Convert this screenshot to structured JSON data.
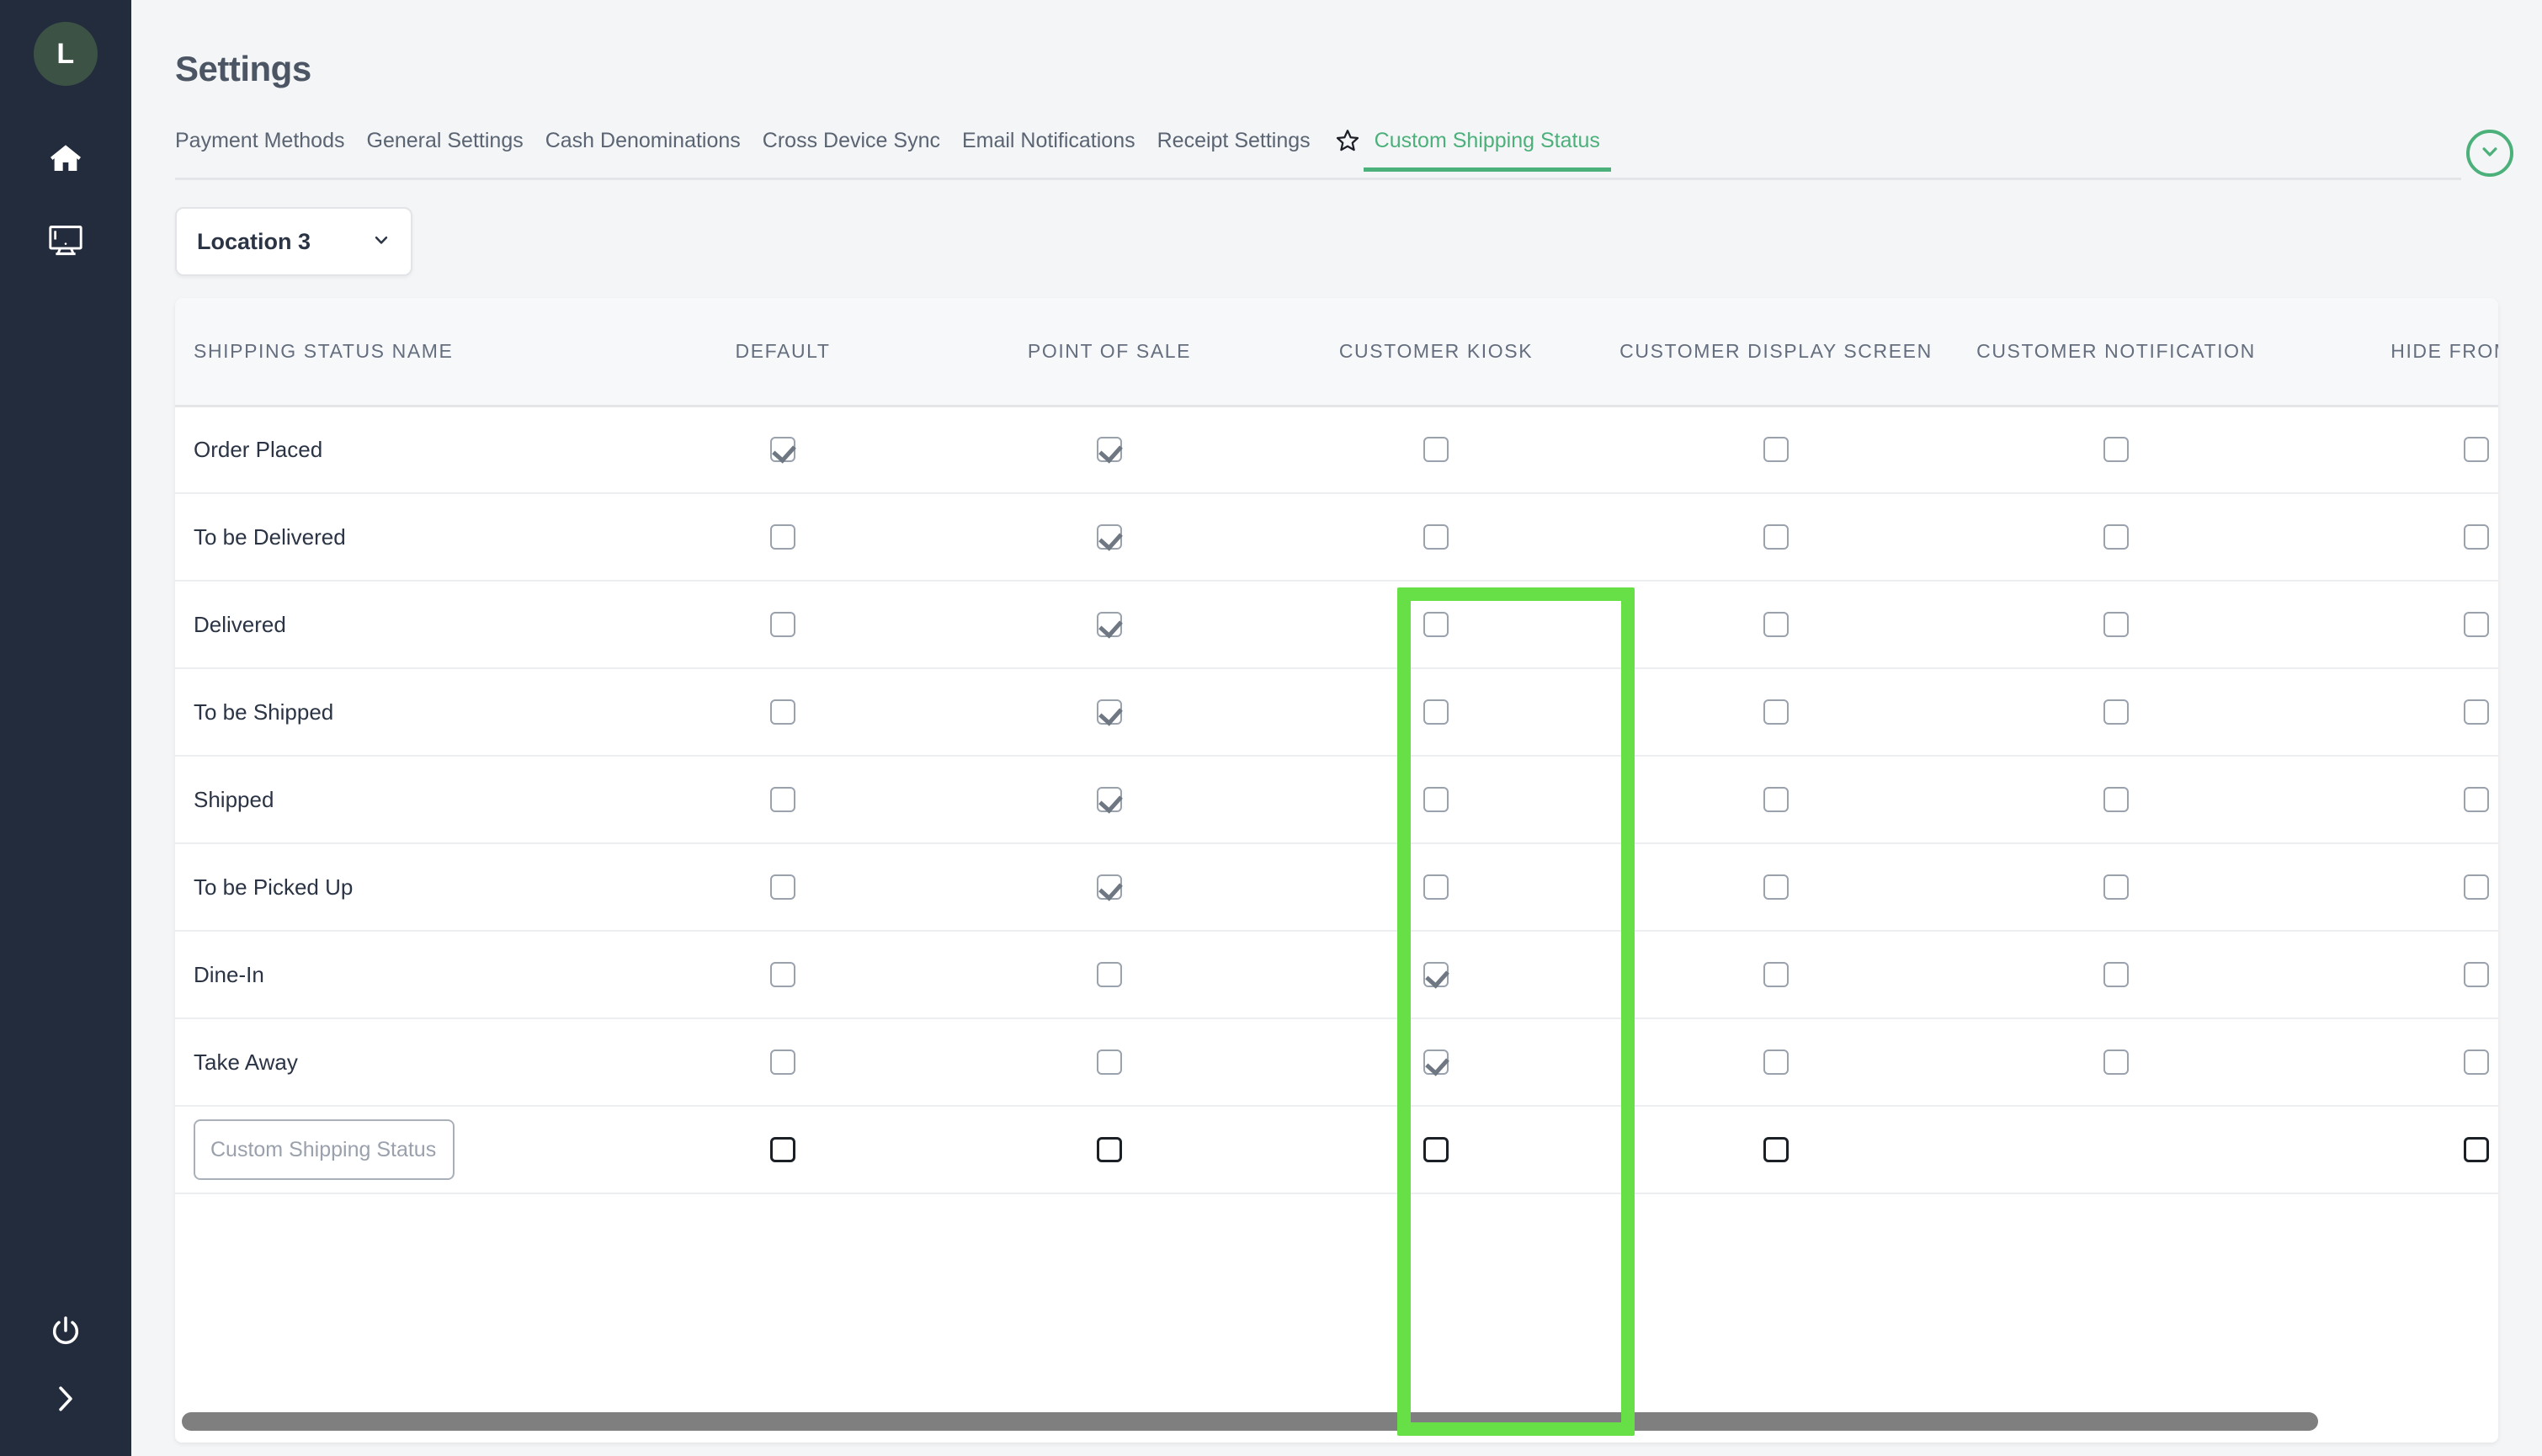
{
  "sidebar": {
    "avatar_initial": "L",
    "items": [
      {
        "name": "home-icon",
        "label": "Home"
      },
      {
        "name": "display-screen-icon",
        "label": "Display Screen"
      }
    ],
    "bottom_items": [
      {
        "name": "power-icon",
        "label": "Power"
      },
      {
        "name": "expand-chevron-icon",
        "label": "Expand"
      }
    ]
  },
  "header": {
    "title": "Settings"
  },
  "tabs": [
    {
      "label": "Payment Methods",
      "active": false
    },
    {
      "label": "General Settings",
      "active": false
    },
    {
      "label": "Cash Denominations",
      "active": false
    },
    {
      "label": "Cross Device Sync",
      "active": false
    },
    {
      "label": "Email Notifications",
      "active": false
    },
    {
      "label": "Receipt Settings",
      "active": false
    },
    {
      "label": "Custom Shipping Status",
      "active": true
    }
  ],
  "toolbar": {
    "collapse_icon": "chevron-down-icon",
    "star_icon": "star-outline-icon"
  },
  "location_select": {
    "value": "Location 3",
    "chevron": "chevron-down-icon"
  },
  "table": {
    "columns": [
      "SHIPPING STATUS NAME",
      "DEFAULT",
      "POINT OF SALE",
      "CUSTOMER KIOSK",
      "CUSTOMER DISPLAY SCREEN",
      "CUSTOMER NOTIFICATION",
      "HIDE FROM KDS"
    ],
    "rows": [
      {
        "name": "Order Placed",
        "default": true,
        "pos": true,
        "kiosk": false,
        "cds": false,
        "notification": false,
        "hide_kds": false
      },
      {
        "name": "To be Delivered",
        "default": false,
        "pos": true,
        "kiosk": false,
        "cds": false,
        "notification": false,
        "hide_kds": false
      },
      {
        "name": "Delivered",
        "default": false,
        "pos": true,
        "kiosk": false,
        "cds": false,
        "notification": false,
        "hide_kds": false
      },
      {
        "name": "To be Shipped",
        "default": false,
        "pos": true,
        "kiosk": false,
        "cds": false,
        "notification": false,
        "hide_kds": false
      },
      {
        "name": "Shipped",
        "default": false,
        "pos": true,
        "kiosk": false,
        "cds": false,
        "notification": false,
        "hide_kds": false
      },
      {
        "name": "To be Picked Up",
        "default": false,
        "pos": true,
        "kiosk": false,
        "cds": false,
        "notification": false,
        "hide_kds": false
      },
      {
        "name": "Dine-In",
        "default": false,
        "pos": false,
        "kiosk": true,
        "cds": false,
        "notification": false,
        "hide_kds": false
      },
      {
        "name": "Take Away",
        "default": false,
        "pos": false,
        "kiosk": true,
        "cds": false,
        "notification": false,
        "hide_kds": false
      }
    ],
    "new_row": {
      "placeholder": "Custom Shipping Status",
      "value": "",
      "default": false,
      "pos": false,
      "kiosk": false,
      "cds": false,
      "notification": null,
      "hide_kds": false
    }
  },
  "colors": {
    "accent_green": "#4cb07a",
    "highlight_green": "#66e046",
    "sidebar_bg": "#232c3d",
    "avatar_bg": "#3c5245",
    "page_bg": "#f4f5f7",
    "text_dark": "#2b3445",
    "header_text": "#646e7e"
  }
}
